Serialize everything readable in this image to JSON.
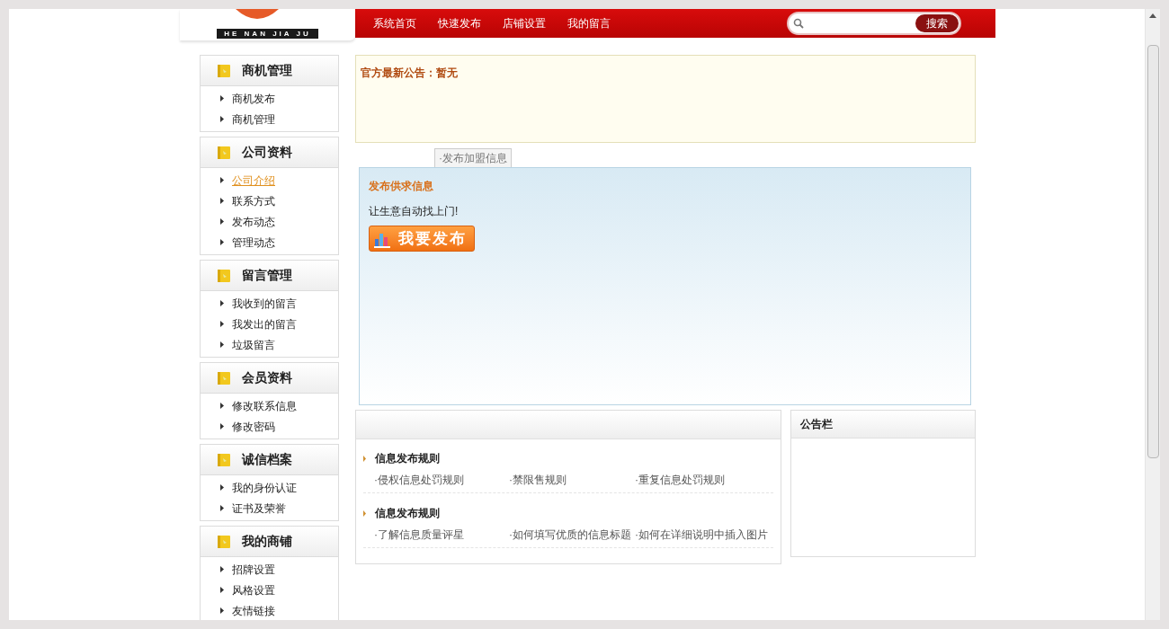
{
  "logo": {
    "text": "HE NAN JIA JU"
  },
  "nav": [
    "系统首页",
    "快速发布",
    "店铺设置",
    "我的留言"
  ],
  "search": {
    "button": "搜索"
  },
  "sidebar": [
    {
      "title": "商机管理",
      "items": [
        {
          "label": "商机发布",
          "selected": false
        },
        {
          "label": "商机管理",
          "selected": false
        }
      ]
    },
    {
      "title": "公司资料",
      "items": [
        {
          "label": "公司介绍",
          "selected": true
        },
        {
          "label": "联系方式",
          "selected": false
        },
        {
          "label": "发布动态",
          "selected": false
        },
        {
          "label": "管理动态",
          "selected": false
        }
      ]
    },
    {
      "title": "留言管理",
      "items": [
        {
          "label": "我收到的留言",
          "selected": false
        },
        {
          "label": "我发出的留言",
          "selected": false
        },
        {
          "label": "垃圾留言",
          "selected": false
        }
      ]
    },
    {
      "title": "会员资料",
      "items": [
        {
          "label": "修改联系信息",
          "selected": false
        },
        {
          "label": "修改密码",
          "selected": false
        }
      ]
    },
    {
      "title": "诚信档案",
      "items": [
        {
          "label": "我的身份认证",
          "selected": false
        },
        {
          "label": "证书及荣誉",
          "selected": false
        }
      ]
    },
    {
      "title": "我的商铺",
      "items": [
        {
          "label": "招牌设置",
          "selected": false
        },
        {
          "label": "风格设置",
          "selected": false
        },
        {
          "label": "友情链接",
          "selected": false
        }
      ]
    }
  ],
  "notice": "官方最新公告：暂无",
  "tabs": [
    {
      "label": "·发布加盟信息",
      "selected": false
    }
  ],
  "publish_panel": {
    "title": "发布供求信息",
    "subtitle": "让生意自动找上门!",
    "button": "我要发布"
  },
  "rules": [
    {
      "title": "信息发布规则",
      "links": [
        "·侵权信息处罚规则",
        "·禁限售规则",
        "·重复信息处罚规则"
      ]
    },
    {
      "title": "信息发布规则",
      "links": [
        "·了解信息质量评星",
        "·如何填写优质的信息标题",
        "·如何在详细说明中插入图片"
      ]
    }
  ],
  "bulletin": {
    "title": "公告栏"
  }
}
